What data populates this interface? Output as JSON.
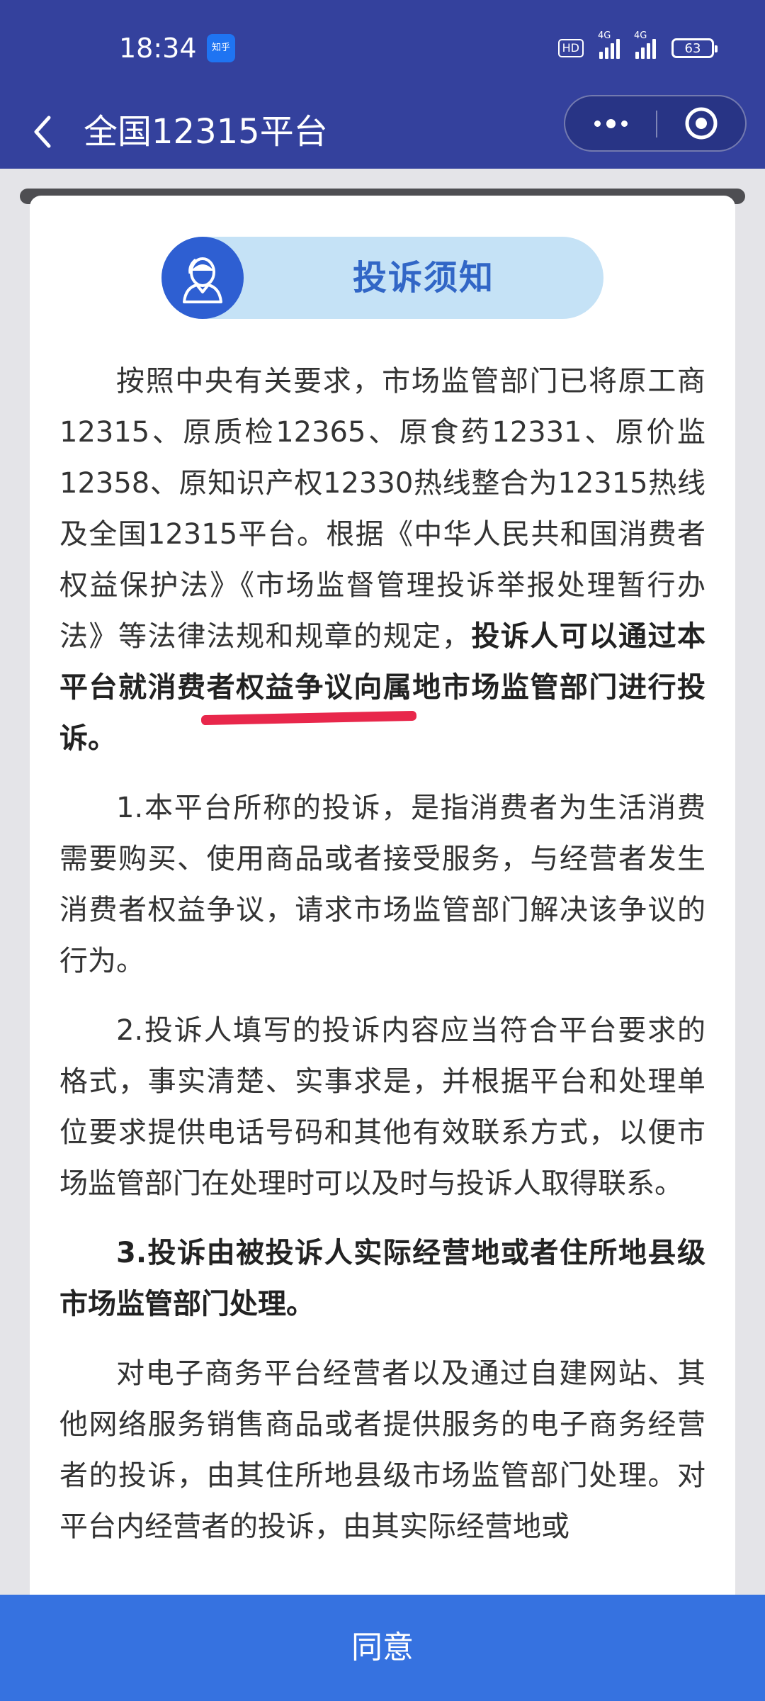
{
  "status_bar": {
    "time": "18:34",
    "app_badge": "知乎",
    "hd": "HD",
    "signal1": "4G",
    "signal2": "4G",
    "battery": "63"
  },
  "header": {
    "title": "全国12315平台"
  },
  "notice": {
    "title": "投诉须知"
  },
  "content": {
    "p1_a": "按照中央有关要求，市场监管部门已将原工商12315、原质检12365、原食药12331、原价监12358、原知识产权12330热线整合为12315热线及全国12315平台。根据《中华人民共和国消费者权益保护法》《市场监督管理投诉举报处理暂行办法》等法律法规和规章的规定，",
    "p1_b": "投诉人可以通过本平台就消费者权益争议向属地市场监管部门进行投诉。",
    "p2": "1.本平台所称的投诉，是指消费者为生活消费需要购买、使用商品或者接受服务，与经营者发生消费者权益争议，请求市场监管部门解决该争议的行为。",
    "p3": "2.投诉人填写的投诉内容应当符合平台要求的格式，事实清楚、实事求是，并根据平台和处理单位要求提供电话号码和其他有效联系方式，以便市场监管部门在处理时可以及时与投诉人取得联系。",
    "p4": "3.投诉由被投诉人实际经营地或者住所地县级市场监管部门处理。",
    "p5": "对电子商务平台经营者以及通过自建网站、其他网络服务销售商品或者提供服务的电子商务经营者的投诉，由其住所地县级市场监管部门处理。对平台内经营者的投诉，由其实际经营地或"
  },
  "footer": {
    "agree_label": "同意"
  },
  "colors": {
    "header_bg": "#34419d",
    "accent": "#3672e0",
    "notice_pill": "#c5e2f6",
    "annotation": "#e8274b"
  },
  "icons": [
    "back-arrow-icon",
    "more-dots-icon",
    "close-target-icon",
    "customer-service-icon"
  ]
}
